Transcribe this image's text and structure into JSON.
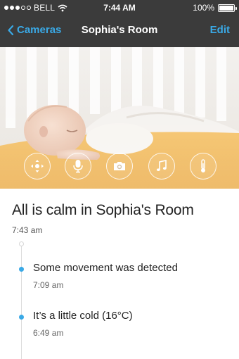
{
  "status_bar": {
    "carrier": "BELL",
    "time": "7:44 AM",
    "battery": "100%",
    "battery_level": 1.0,
    "signal_bars_filled": 3,
    "signal_bars_total": 5
  },
  "nav": {
    "back_label": "Cameras",
    "title": "Sophia's Room",
    "edit_label": "Edit"
  },
  "controls": [
    {
      "icon": "pan-tilt-icon"
    },
    {
      "icon": "microphone-icon"
    },
    {
      "icon": "camera-icon"
    },
    {
      "icon": "music-note-icon"
    },
    {
      "icon": "thermometer-icon"
    }
  ],
  "status": {
    "headline": "All is calm in Sophia's Room",
    "time": "7:43 am"
  },
  "events": [
    {
      "text": "Some movement was detected",
      "time": "7:09 am"
    },
    {
      "text": "It’s a little cold (16°C)",
      "time": "6:49 am"
    }
  ],
  "colors": {
    "accent": "#3aa9e6",
    "header_bg": "#3b3b3b",
    "mattress": "#f2b34d"
  }
}
